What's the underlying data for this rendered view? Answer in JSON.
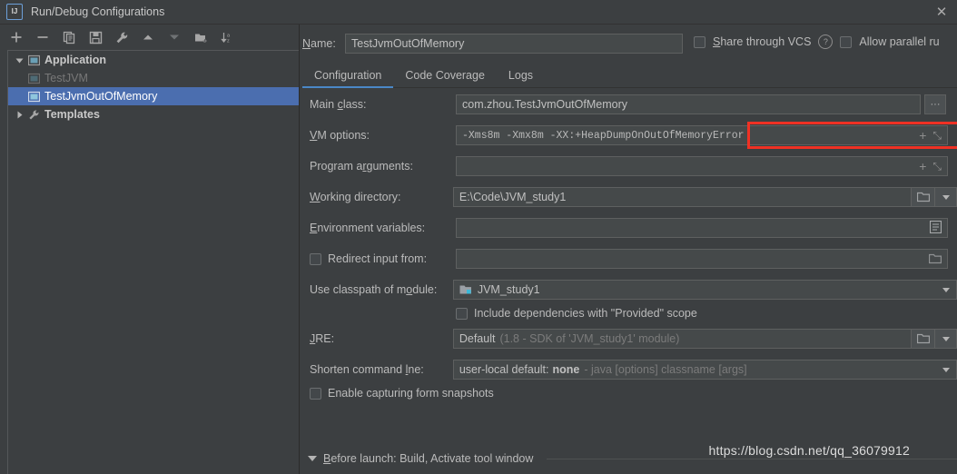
{
  "window": {
    "title": "Run/Debug Configurations",
    "app_icon_text": "IJ",
    "close_label": "✕"
  },
  "toolbar": {
    "icons": [
      {
        "name": "add-icon",
        "label": "+"
      },
      {
        "name": "remove-icon",
        "label": "−"
      },
      {
        "name": "copy-icon",
        "label": "copy"
      },
      {
        "name": "save-icon",
        "label": "save"
      },
      {
        "name": "edit-templates-icon",
        "label": "wrench"
      },
      {
        "name": "move-up-icon",
        "label": "up"
      },
      {
        "name": "move-down-icon",
        "label": "down"
      },
      {
        "name": "new-folder-icon",
        "label": "folder-plus"
      },
      {
        "name": "sort-alphabetically-icon",
        "label": "sort-az"
      }
    ]
  },
  "tree": {
    "nodes": [
      {
        "label": "Application",
        "type": "group",
        "expanded": true,
        "selected": false,
        "dim": false
      },
      {
        "label": "TestJVM",
        "type": "config",
        "expanded": null,
        "selected": false,
        "dim": true
      },
      {
        "label": "TestJvmOutOfMemory",
        "type": "config",
        "expanded": null,
        "selected": true,
        "dim": false
      },
      {
        "label": "Templates",
        "type": "templates",
        "expanded": false,
        "selected": false,
        "dim": false
      }
    ]
  },
  "name_row": {
    "label": "Name:",
    "value": "TestJvmOutOfMemory",
    "share_through_vcs": {
      "label": "Share through VCS",
      "checked": false,
      "help": "?"
    },
    "allow_parallel_run": {
      "label": "Allow parallel ru",
      "checked": false
    }
  },
  "tabs": [
    {
      "label": "Configuration",
      "active": true
    },
    {
      "label": "Code Coverage",
      "active": false
    },
    {
      "label": "Logs",
      "active": false
    }
  ],
  "fields": {
    "main_class": {
      "label": "Main class:",
      "value": "com.zhou.TestJvmOutOfMemory",
      "browse_button": "···"
    },
    "vm_options": {
      "label": "VM options:",
      "value": "-Xms8m -Xmx8m -XX:+HeapDumpOnOutOfMemoryError",
      "highlight_color": "#ef3124",
      "expand_icon": "⤡",
      "add_icon": "+"
    },
    "program_arguments": {
      "label": "Program arguments:",
      "value": "",
      "expand_icon": "⤡",
      "add_icon": "+"
    },
    "working_directory": {
      "label": "Working directory:",
      "value": "E:\\Code\\JVM_study1"
    },
    "environment_variables": {
      "label": "Environment variables:",
      "value": ""
    },
    "redirect_input": {
      "label": "Redirect input from:",
      "checked": false,
      "value": ""
    },
    "use_classpath_of_module": {
      "label": "Use classpath of module:",
      "value": "JVM_study1"
    },
    "include_provided_scope": {
      "label": "Include dependencies with \"Provided\" scope",
      "checked": false
    },
    "jre": {
      "label": "JRE:",
      "value": "Default",
      "hint": "(1.8 - SDK of 'JVM_study1' module)"
    },
    "shorten_command_line": {
      "label": "Shorten command line:",
      "value_prefix": "user-local default:",
      "value_bold": "none",
      "hint": "- java [options] classname [args]"
    },
    "enable_form_snapshots": {
      "label": "Enable capturing form snapshots",
      "checked": false
    }
  },
  "before_launch": {
    "label": "Before launch: Build, Activate tool window"
  },
  "watermark": {
    "text": "https://blog.csdn.net/qq_36079912"
  },
  "colors": {
    "background": "#3c3f41",
    "field_background": "#45494a",
    "selection": "#4b6eaf",
    "accent": "#4a88c7",
    "highlight_red": "#ef3124",
    "text": "#bbbbbb"
  }
}
